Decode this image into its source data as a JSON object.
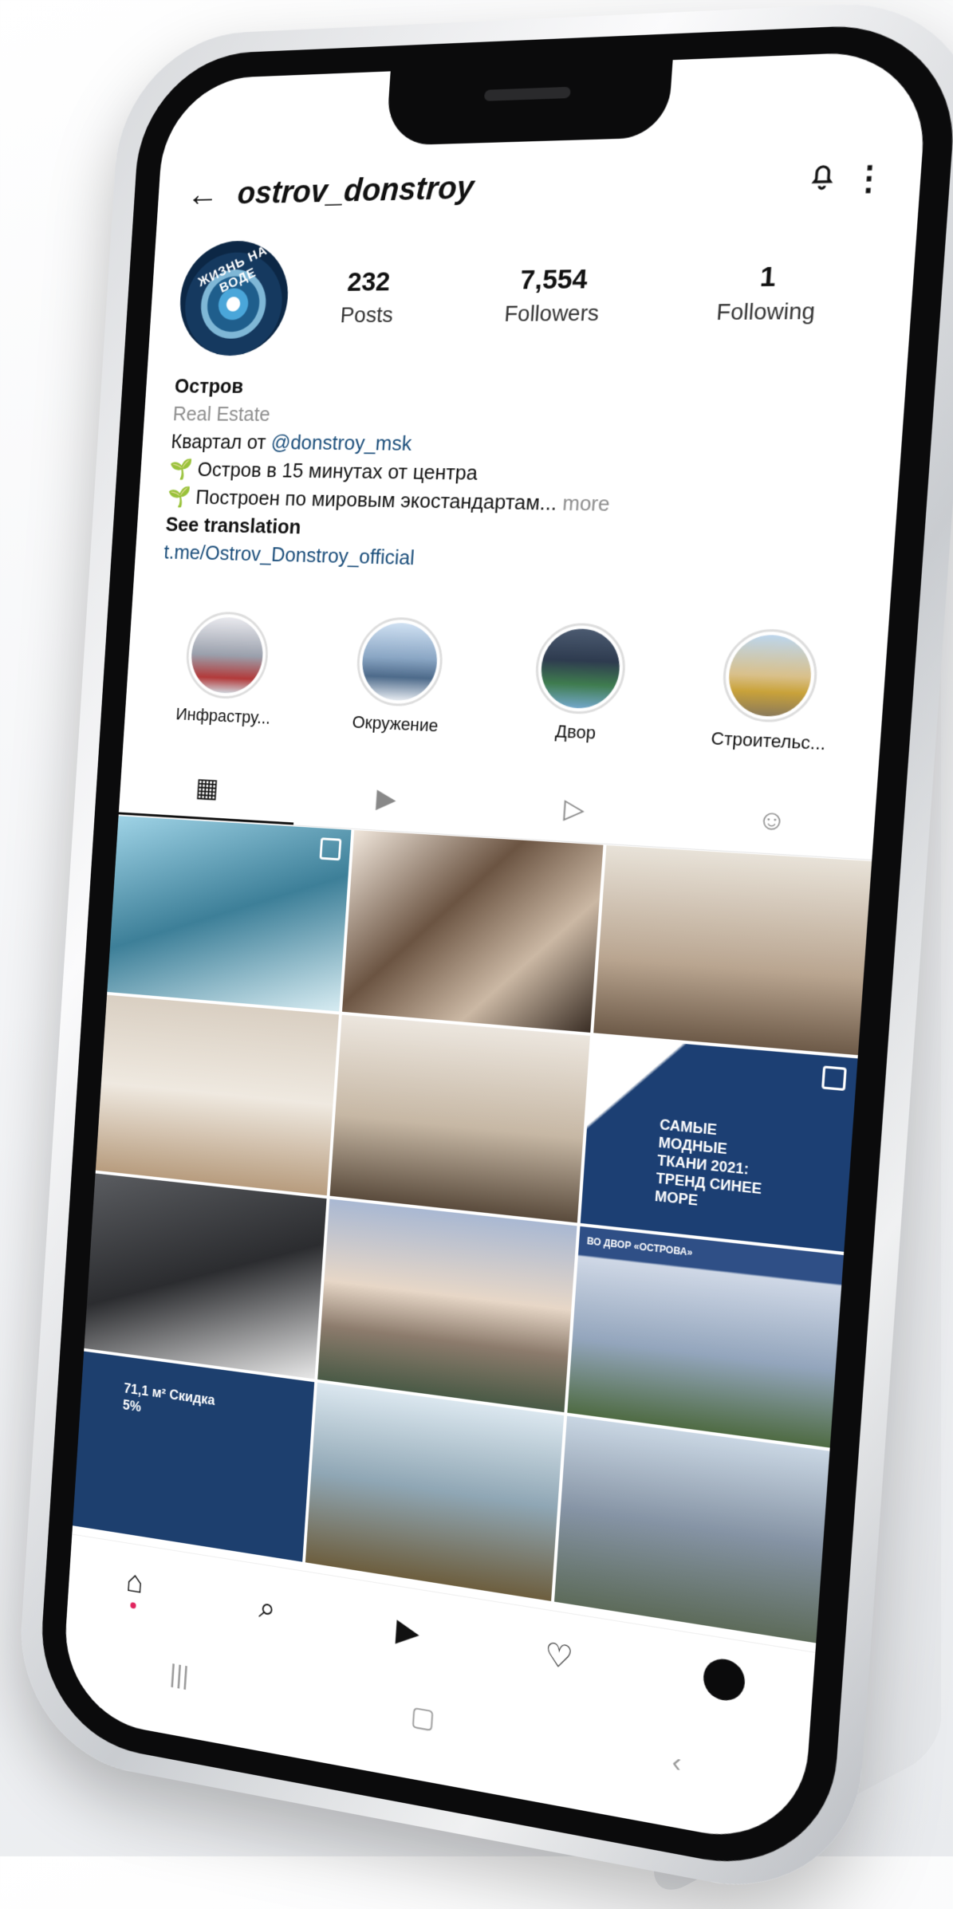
{
  "header": {
    "username": "ostrov_donstroy",
    "back_icon": "←",
    "bell_icon": "🔔",
    "more_icon": "⋮"
  },
  "avatar": {
    "text": "ЖИЗНЬ НА ВОДЕ"
  },
  "stats": [
    {
      "value": "232",
      "label": "Posts"
    },
    {
      "value": "7,554",
      "label": "Followers"
    },
    {
      "value": "1",
      "label": "Following"
    }
  ],
  "bio": {
    "name": "Остров",
    "category": "Real Estate",
    "line1_prefix": "Квартал от ",
    "line1_mention": "@donstroy_msk",
    "line2": "🌱 Остров в 15 минутах от центра",
    "line3": "🌱 Построен по мировым экостандартам...",
    "more": "more",
    "see_translation": "See translation",
    "link": "t.me/Ostrov_Donstroy_official"
  },
  "highlights": [
    {
      "label": "Инфрастру..."
    },
    {
      "label": "Окружение"
    },
    {
      "label": "Двор"
    },
    {
      "label": "Строительс..."
    }
  ],
  "tabs": [
    {
      "icon": "grid-icon",
      "glyph": "▦"
    },
    {
      "icon": "reels-icon",
      "glyph": "▶"
    },
    {
      "icon": "video-icon",
      "glyph": "▷"
    },
    {
      "icon": "tagged-icon",
      "glyph": "☺"
    }
  ],
  "posts": [
    {
      "caption": ""
    },
    {
      "caption": ""
    },
    {
      "caption": ""
    },
    {
      "caption": ""
    },
    {
      "caption": ""
    },
    {
      "caption": "САМЫЕ МОДНЫЕ ТКАНИ 2021: ТРЕНД СИНЕЕ МОРЕ"
    },
    {
      "caption": ""
    },
    {
      "caption": ""
    },
    {
      "caption": "ВО ДВОР «ОСТРОВА»"
    },
    {
      "caption": "71,1 м² Скидка 5%"
    },
    {
      "caption": ""
    },
    {
      "caption": ""
    }
  ],
  "bottom_nav": {
    "home_icon": "⌂",
    "search_icon": "⌕",
    "reels_icon": "▶",
    "heart_icon": "♡"
  },
  "system_nav": {
    "recent": "|||",
    "home": "▢",
    "back": "‹"
  }
}
